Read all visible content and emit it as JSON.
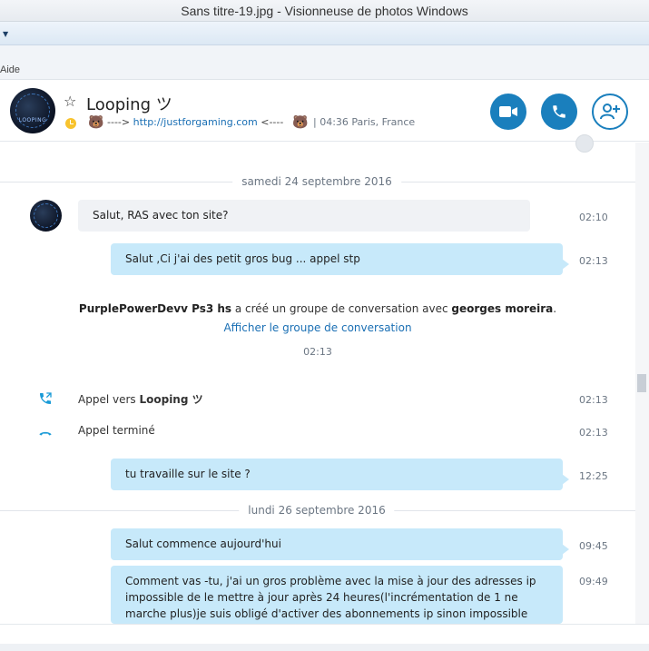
{
  "window": {
    "title": "Sans titre-19.jpg - Visionneuse de photos Windows"
  },
  "menu": {
    "help": "Aide"
  },
  "contact": {
    "name": "Looping ツ",
    "mood_prefix": "---->",
    "mood_link": "http://justforgaming.com",
    "mood_suffix": "<----",
    "separator": "|",
    "location": "04:36 Paris, France",
    "avatar_text": "LOOPING"
  },
  "actions": {
    "video_label": "video-call",
    "call_label": "audio-call",
    "add_label": "add-contact"
  },
  "conversation": {
    "date1": "samedi 24 septembre 2016",
    "msg1": "Salut, RAS avec ton site?",
    "msg1_time": "02:10",
    "msg2": "Salut ,Ci j'ai des petit gros bug ... appel stp",
    "msg2_time": "02:13",
    "sys_user": "PurplePowerDevv Ps3 hs",
    "sys_text": " a créé un groupe de conversation avec ",
    "sys_target": "georges moreira",
    "sys_end": ".",
    "sys_link": "Afficher le groupe de conversation",
    "sys_time": "02:13",
    "call1_prefix": "Appel vers ",
    "call1_name": "Looping ツ",
    "call1_time": "02:13",
    "call2": "Appel terminé",
    "call2_time": "02:13",
    "msg3": "tu travaille sur le site ?",
    "msg3_time": "12:25",
    "date2": "lundi 26 septembre 2016",
    "msg4": "Salut commence aujourd'hui",
    "msg4_time": "09:45",
    "msg5": "Comment vas -tu,  j'ai un gros problème avec la mise à jour des adresses ip impossible de le mettre à jour après 24 heures(l'incrémentation de 1 ne marche plus)je suis obligé d'activer des abonnements ip sinon impossible",
    "msg5_time": "09:49"
  },
  "colors": {
    "accent": "#1a7fbd",
    "bubble_out": "#c7e9fa",
    "bubble_in": "#f0f2f5",
    "status": "#f8c32e"
  }
}
